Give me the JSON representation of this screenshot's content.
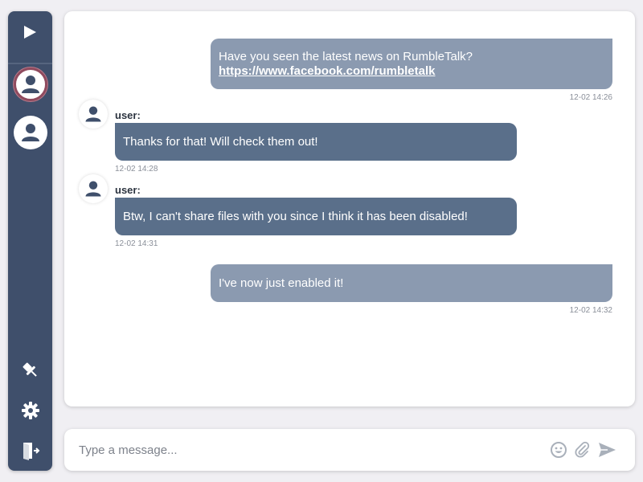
{
  "sidebar": {
    "icons": [
      "play-icon",
      "user-icon",
      "pin-icon",
      "gear-icon",
      "exit-icon"
    ],
    "active_user_ring_color": "#8f4a5e",
    "background": "#3f4f6b"
  },
  "messages": [
    {
      "direction": "outgoing",
      "text": "Have you seen the latest news on RumbleTalk?",
      "link": "https://www.facebook.com/rumbletalk",
      "time": "12-02 14:26"
    },
    {
      "direction": "incoming",
      "user": "user:",
      "text": "Thanks for that! Will check them out!",
      "time": "12-02 14:28"
    },
    {
      "direction": "incoming",
      "user": "user:",
      "text": "Btw, I can't share files with you since I think it has been disabled!",
      "time": "12-02 14:31"
    },
    {
      "direction": "outgoing",
      "text": "I've now just enabled it!",
      "time": "12-02 14:32"
    }
  ],
  "composer": {
    "placeholder": "Type a message...",
    "value": "",
    "icons": [
      "emoji-icon",
      "attach-icon",
      "send-icon"
    ]
  },
  "colors": {
    "outgoing_bubble": "#8b9ab0",
    "incoming_bubble": "#5a6f8a",
    "icon_gray": "#a9b0ba"
  }
}
